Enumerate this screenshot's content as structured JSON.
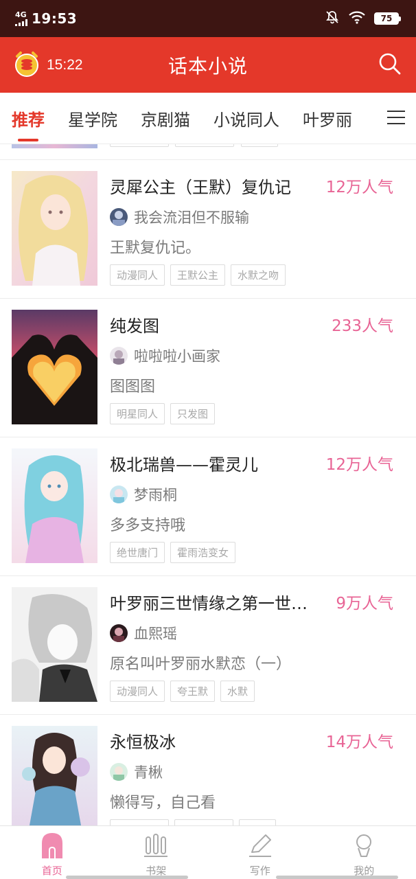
{
  "status_bar": {
    "network": "4G",
    "time": "19:53",
    "battery": "75"
  },
  "header": {
    "alarm_time": "15:22",
    "title": "话本小说"
  },
  "tabs": [
    "推荐",
    "星学院",
    "京剧猫",
    "小说同人",
    "叶罗丽"
  ],
  "books": [
    {
      "title": "灵犀公主（王默）复仇记",
      "popularity": "12万人气",
      "author": "我会流泪但不服输",
      "description": "王默复仇记。",
      "tags": [
        "动漫同人",
        "王默公主",
        "水默之吻"
      ]
    },
    {
      "title": "纯发图",
      "popularity": "233人气",
      "author": "啦啦啦小画家",
      "description": "图图图",
      "tags": [
        "明星同人",
        "只发图"
      ]
    },
    {
      "title": "极北瑞兽——霍灵儿",
      "popularity": "12万人气",
      "author": "梦雨桐",
      "description": "多多支持哦",
      "tags": [
        "绝世唐门",
        "霍雨浩变女"
      ]
    },
    {
      "title": "叶罗丽三世情缘之第一世（…",
      "popularity": "9万人气",
      "author": "血熙瑶",
      "description": "原名叫叶罗丽水默恋（一）",
      "tags": [
        "动漫同人",
        "夸王默",
        "水默"
      ]
    },
    {
      "title": "永恒极冰",
      "popularity": "14万人气",
      "author": "青楸",
      "description": "懒得写，自己看",
      "tags": []
    }
  ],
  "bottom_nav": [
    {
      "label": "首页",
      "icon": "home-icon"
    },
    {
      "label": "书架",
      "icon": "bookshelf-icon"
    },
    {
      "label": "写作",
      "icon": "pencil-icon"
    },
    {
      "label": "我的",
      "icon": "profile-icon"
    }
  ],
  "colors": {
    "status_bar": "#3d1512",
    "header": "#e4382a",
    "accent": "#e4382a",
    "popularity": "#e86495"
  }
}
